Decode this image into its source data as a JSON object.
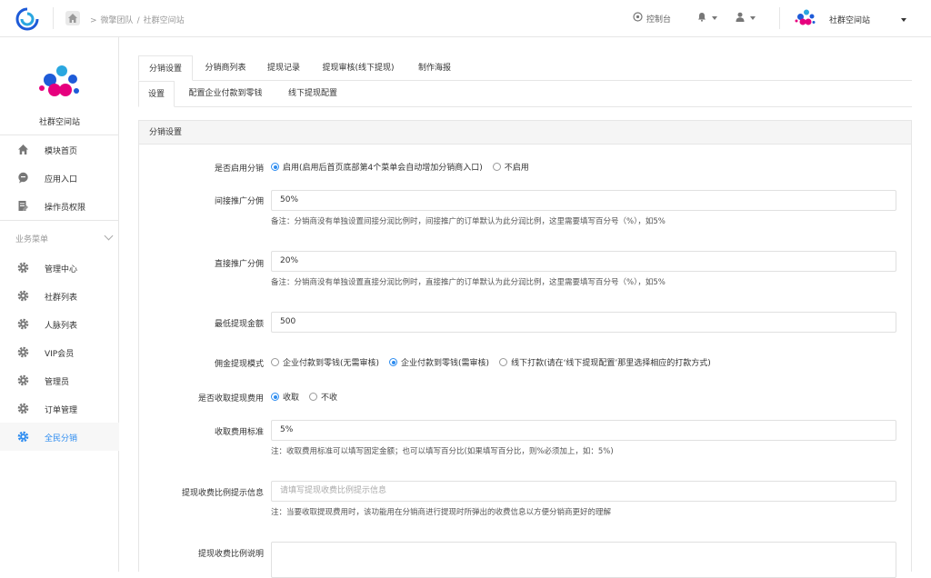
{
  "header": {
    "breadcrumb": [
      "微擎团队",
      "社群空间站"
    ],
    "console_label": "控制台",
    "account_name": "社群空间站"
  },
  "sidebar": {
    "site_name": "社群空间站",
    "items_top": [
      {
        "label": "模块首页",
        "icon": "home-icon"
      },
      {
        "label": "应用入口",
        "icon": "chat-icon"
      },
      {
        "label": "操作员权限",
        "icon": "doc-edit-icon"
      }
    ],
    "section_label": "业务菜单",
    "items_business": [
      {
        "label": "管理中心",
        "icon": "gear-icon"
      },
      {
        "label": "社群列表",
        "icon": "gear-icon"
      },
      {
        "label": "人脉列表",
        "icon": "gear-icon"
      },
      {
        "label": "VIP会员",
        "icon": "gear-icon"
      },
      {
        "label": "管理员",
        "icon": "gear-icon"
      },
      {
        "label": "订单管理",
        "icon": "gear-icon"
      },
      {
        "label": "全民分销",
        "icon": "gear-icon",
        "active": true
      }
    ]
  },
  "tabs_main": [
    "分销设置",
    "分销商列表",
    "提现记录",
    "提现审核(线下提现)",
    "制作海报"
  ],
  "tabs_sub": [
    "设置",
    "配置企业付款到零钱",
    "线下提现配置"
  ],
  "panel": {
    "title": "分销设置",
    "enable": {
      "label": "是否启用分销",
      "option_on": "启用(启用后首页底部第4个菜单会自动增加分销商入口)",
      "option_off": "不启用"
    },
    "indirect": {
      "label": "间接推广分佣",
      "value": "50%",
      "note": "备注：分销商没有单独设置间接分润比例时，间接推广的订单默认为此分润比例，这里需要填写百分号（%），如5%"
    },
    "direct": {
      "label": "直接推广分佣",
      "value": "20%",
      "note": "备注：分销商没有单独设置直接分润比例时，直接推广的订单默认为此分润比例，这里需要填写百分号（%），如5%"
    },
    "min_withdraw": {
      "label": "最低提现金额",
      "value": "500"
    },
    "mode": {
      "label": "佣金提现模式",
      "options": [
        "企业付款到零钱(无需审核)",
        "企业付款到零钱(需审核)",
        "线下打款(请在‘线下提现配置’那里选择相应的打款方式)"
      ]
    },
    "fee": {
      "label": "是否收取提现费用",
      "option_on": "收取",
      "option_off": "不收"
    },
    "fee_standard": {
      "label": "收取费用标准",
      "value": "5%",
      "note": "注：收取费用标准可以填写固定金额；也可以填写百分比(如果填写百分比，则%必须加上，如：5%)"
    },
    "fee_tip": {
      "label": "提现收费比例提示信息",
      "placeholder": "请填写提现收费比例提示信息",
      "note": "注：当要收取提现费用时，该功能用在分销商进行提现时所弹出的收费信息以方便分销商更好的理解"
    },
    "fee_desc": {
      "label": "提现收费比例说明"
    }
  },
  "colors": {
    "accent": "#2d8cf0",
    "brand_pink": "#e6007e",
    "brand_blue": "#1e5bd8",
    "brand_cyan": "#2aa7e0"
  }
}
